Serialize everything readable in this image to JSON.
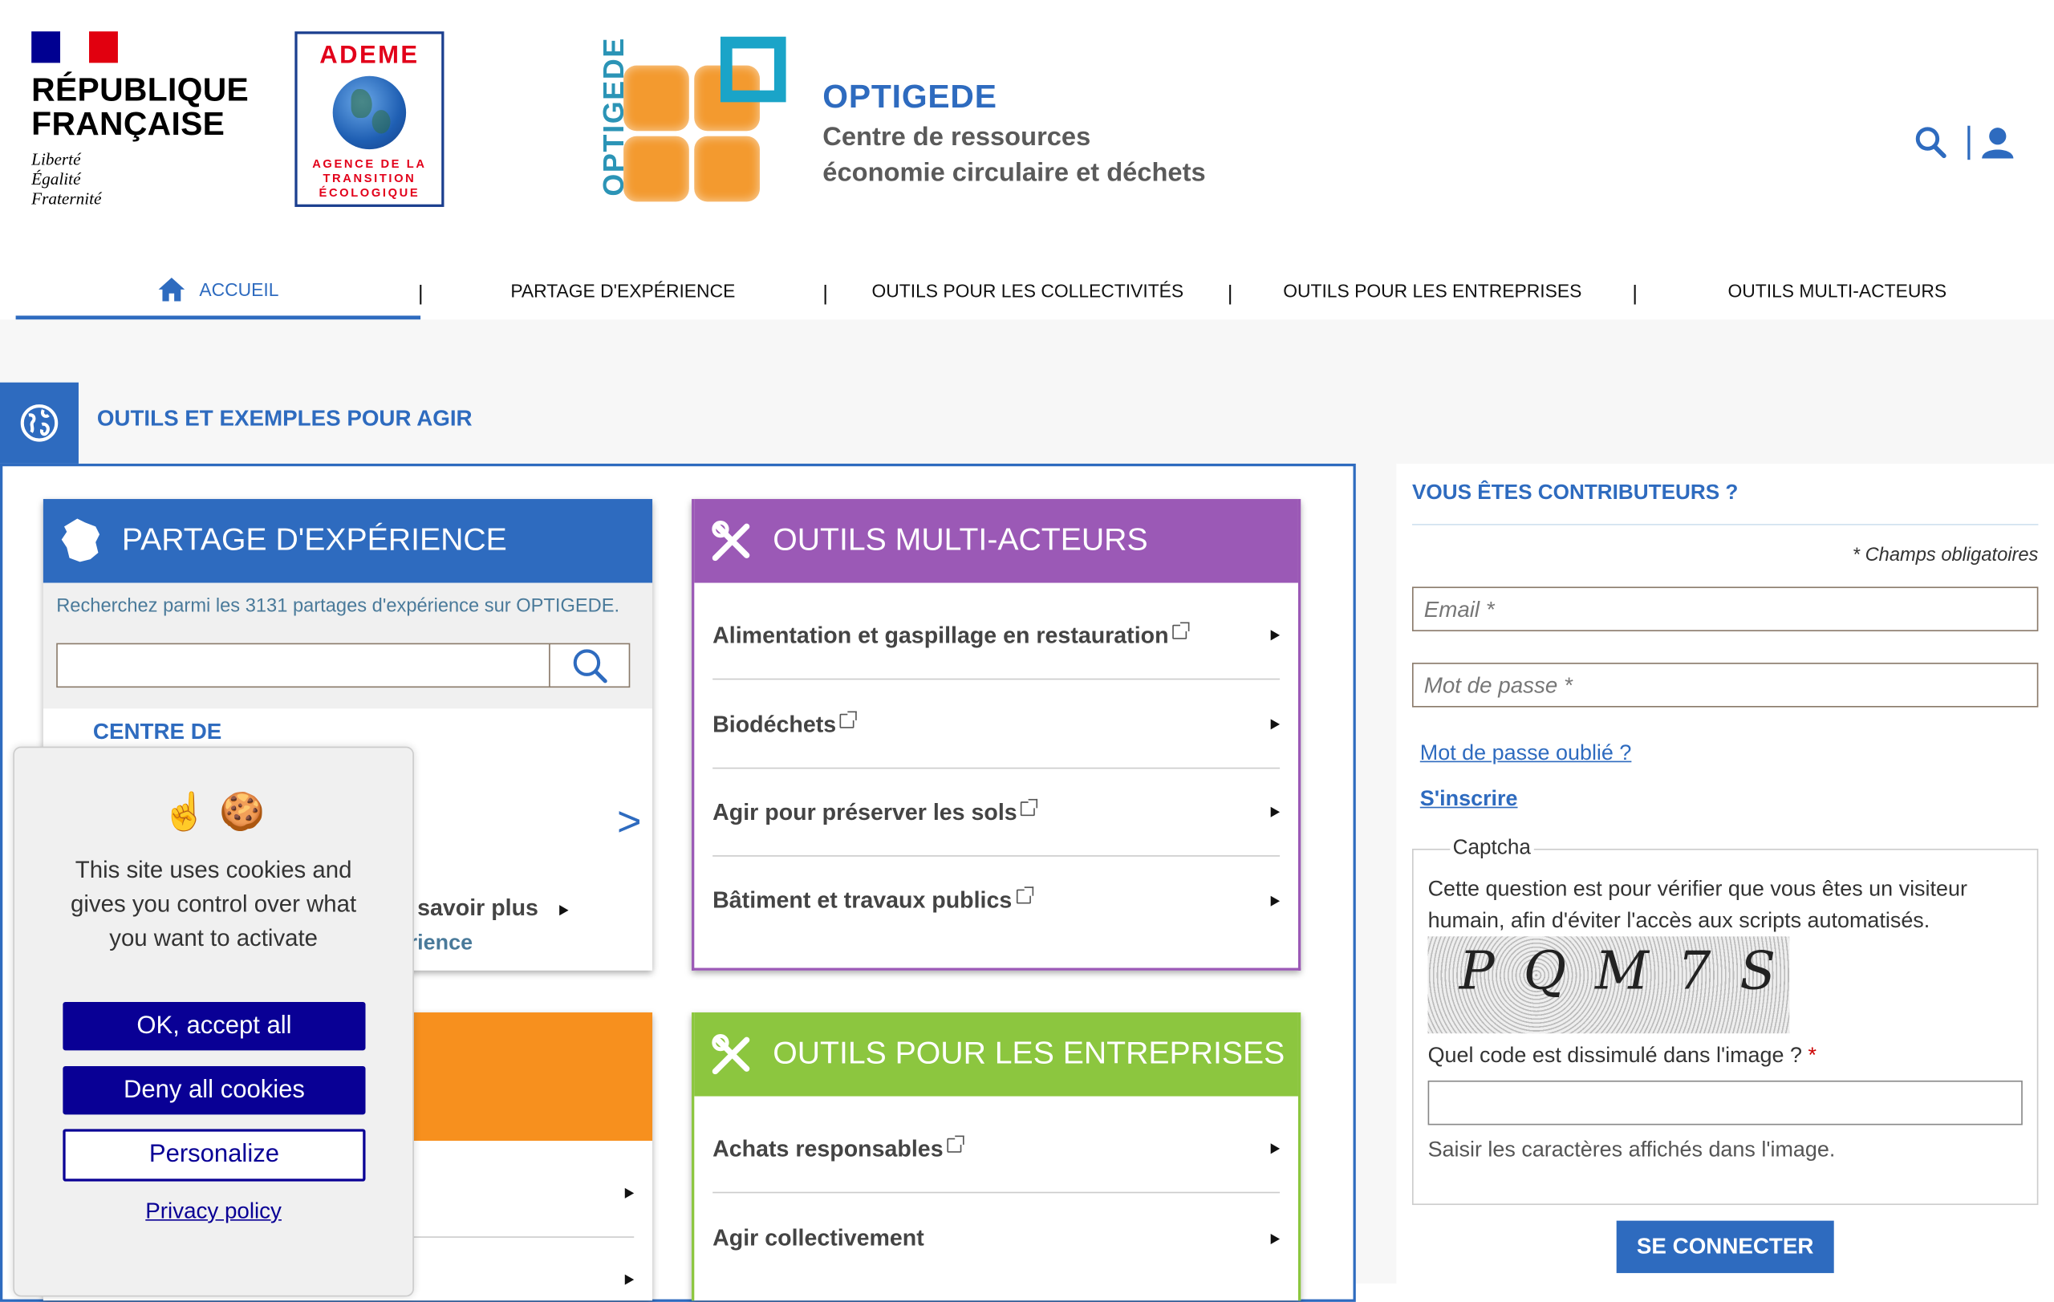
{
  "logos": {
    "rf_name": "RÉPUBLIQUE\nFRANÇAISE",
    "rf_motto": "Liberté\nÉgalité\nFraternité",
    "ademe_title": "ADEME",
    "ademe_sub": "AGENCE DE LA\nTRANSITION\nÉCOLOGIQUE",
    "optigede_vertical": "OPTIGEDE"
  },
  "site": {
    "name": "OPTIGEDE",
    "tagline": "Centre de ressources\néconomie circulaire et déchets"
  },
  "header_icons": [
    "search-icon",
    "user-icon"
  ],
  "nav": {
    "items": [
      "ACCUEIL",
      "PARTAGE D'EXPÉRIENCE",
      "OUTILS POUR LES COLLECTIVITÉS",
      "OUTILS POUR LES ENTREPRISES",
      "OUTILS MULTI-ACTEURS"
    ],
    "active": "ACCUEIL",
    "separator": "|"
  },
  "section": {
    "title": "OUTILS ET EXEMPLES POUR AGIR"
  },
  "cards": {
    "partage": {
      "title": "PARTAGE D'EXPÉRIENCE",
      "search_hint": "Recherchez parmi les 3131 partages d'expérience sur OPTIGEDE.",
      "centre": "CENTRE DE",
      "arrow": ">",
      "savoir_plus": "n savoir plus",
      "experience": "érience"
    },
    "multi": {
      "title": "OUTILS MULTI-ACTEURS",
      "items": [
        "Alimentation et gaspillage en restauration",
        "Biodéchets",
        "Agir pour préserver les sols",
        "Bâtiment et travaux publics"
      ]
    },
    "entreprises": {
      "title": "OUTILS POUR LES ENTREPRISES",
      "items": [
        "Achats responsables",
        "Agir collectivement"
      ]
    },
    "colors": {
      "blue": "#2e6bbf",
      "purple": "#9b59b6",
      "green": "#8cc63f",
      "orange": "#f7901e"
    }
  },
  "login": {
    "title": "VOUS ÊTES CONTRIBUTEURS ?",
    "required_note": "* Champs obligatoires",
    "email_placeholder": "Email  *",
    "password_placeholder": "Mot de passe *",
    "forgot": "Mot de passe oublié ?",
    "register": "S'inscrire",
    "captcha_legend": "Captcha",
    "captcha_text": "Cette question est pour vérifier que vous êtes un visiteur humain, afin d'éviter l'accès aux scripts automatisés.",
    "captcha_image_text": "PQM7S",
    "captcha_question": "Quel code est dissimulé dans l'image ?",
    "captcha_required": "*",
    "captcha_help": "Saisir les caractères affichés dans l'image.",
    "submit": "SE CONNECTER"
  },
  "cookie": {
    "emoji": "☝️ 🍪",
    "text": "This site uses cookies and gives you control over what you want to activate",
    "accept": "OK, accept all",
    "deny": "Deny all cookies",
    "personalize": "Personalize",
    "privacy": "Privacy policy"
  }
}
